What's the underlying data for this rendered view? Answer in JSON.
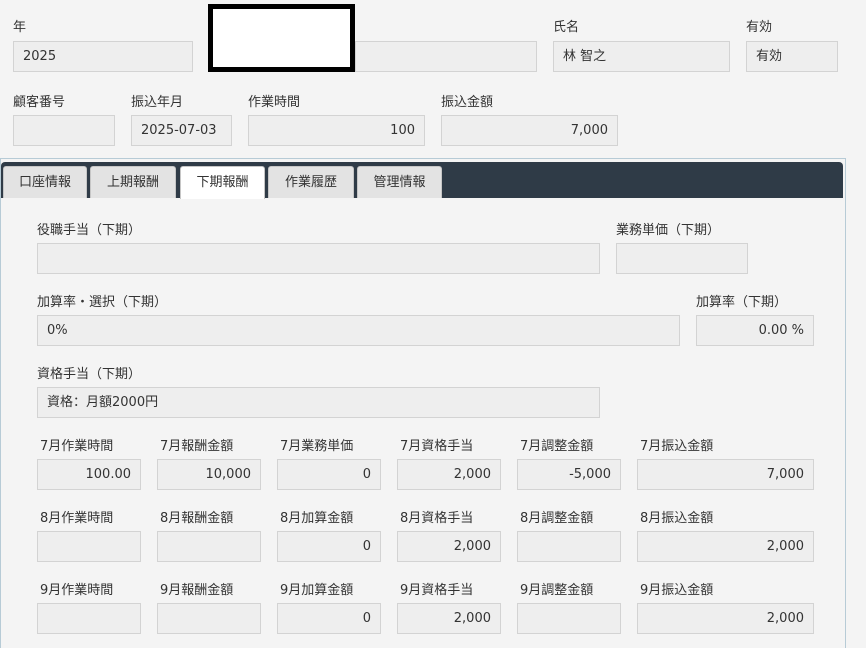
{
  "header": {
    "year_label": "年",
    "year_value": "2025",
    "name_label": "氏名",
    "name_value": "林 智之",
    "valid_label": "有効",
    "valid_value": "有効",
    "customer_no_label": "顧客番号",
    "customer_no_value": "",
    "transfer_date_label": "振込年月",
    "transfer_date_value": "2025-07-03",
    "work_hours_label": "作業時間",
    "work_hours_value": "100",
    "transfer_amount_label": "振込金額",
    "transfer_amount_value": "7,000"
  },
  "tabs": [
    {
      "label": "口座情報"
    },
    {
      "label": "上期報酬"
    },
    {
      "label": "下期報酬",
      "active": true
    },
    {
      "label": "作業履歴"
    },
    {
      "label": "管理情報"
    }
  ],
  "second_half": {
    "position_allowance_label": "役職手当（下期）",
    "position_allowance_value": "",
    "unit_price_label": "業務単価（下期）",
    "unit_price_value": "",
    "add_rate_select_label": "加算率・選択（下期）",
    "add_rate_select_value": "0%",
    "add_rate_label": "加算率（下期）",
    "add_rate_value": "0.00 %",
    "qualification_label": "資格手当（下期）",
    "qualification_value": "資格：月額2000円"
  },
  "months": [
    {
      "labels": [
        "7月作業時間",
        "7月報酬金額",
        "7月業務単価",
        "7月資格手当",
        "7月調整金額",
        "7月振込金額"
      ],
      "values": [
        "100.00",
        "10,000",
        "0",
        "2,000",
        "-5,000",
        "7,000"
      ]
    },
    {
      "labels": [
        "8月作業時間",
        "8月報酬金額",
        "8月加算金額",
        "8月資格手当",
        "8月調整金額",
        "8月振込金額"
      ],
      "values": [
        "",
        "",
        "0",
        "2,000",
        "",
        "2,000"
      ]
    },
    {
      "labels": [
        "9月作業時間",
        "9月報酬金額",
        "9月加算金額",
        "9月資格手当",
        "9月調整金額",
        "9月振込金額"
      ],
      "values": [
        "",
        "",
        "0",
        "2,000",
        "",
        "2,000"
      ]
    }
  ]
}
